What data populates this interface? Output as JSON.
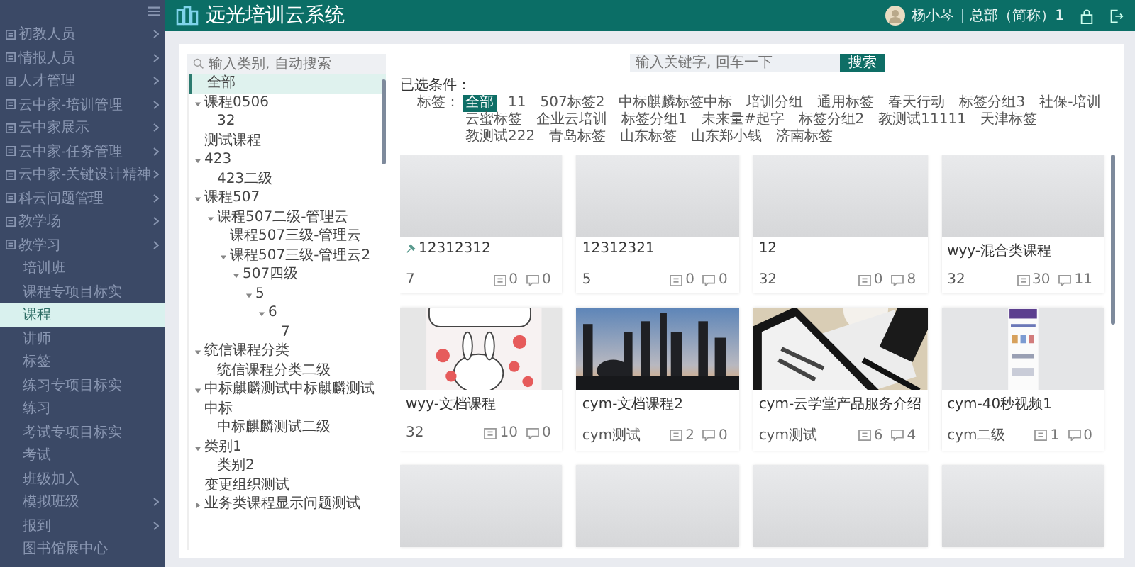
{
  "sidebar": {
    "items": [
      {
        "label": "初教人员",
        "kind": "group",
        "selected": false
      },
      {
        "label": "情报人员",
        "kind": "group",
        "selected": false
      },
      {
        "label": "人才管理",
        "kind": "group",
        "selected": false
      },
      {
        "label": "云中家-培训管理",
        "kind": "group",
        "selected": false
      },
      {
        "label": "云中家展示",
        "kind": "group",
        "selected": false
      },
      {
        "label": "云中家-任务管理",
        "kind": "group",
        "selected": false
      },
      {
        "label": "云中家-关键设计精神",
        "kind": "group",
        "selected": false
      },
      {
        "label": "科云问题管理",
        "kind": "group",
        "selected": false
      },
      {
        "label": "教学场",
        "kind": "group",
        "selected": false
      },
      {
        "label": "教学习",
        "kind": "group",
        "selected": false
      },
      {
        "label": "培训班",
        "kind": "link",
        "selected": false
      },
      {
        "label": "课程专项目标实",
        "kind": "link",
        "selected": false
      },
      {
        "label": "课程",
        "kind": "link",
        "selected": true
      },
      {
        "label": "讲师",
        "kind": "link",
        "selected": false
      },
      {
        "label": "标签",
        "kind": "link",
        "selected": false
      },
      {
        "label": "练习专项目标实",
        "kind": "link",
        "selected": false
      },
      {
        "label": "练习",
        "kind": "link",
        "selected": false
      },
      {
        "label": "考试专项目标实",
        "kind": "link",
        "selected": false
      },
      {
        "label": "考试",
        "kind": "link",
        "selected": false
      },
      {
        "label": "班级加入",
        "kind": "link",
        "selected": false
      },
      {
        "label": "模拟班级",
        "kind": "submenu",
        "selected": false
      },
      {
        "label": "报到",
        "kind": "submenu",
        "selected": false
      },
      {
        "label": "图书馆展中心",
        "kind": "link",
        "selected": false
      }
    ]
  },
  "header": {
    "title": "远光培训云系统",
    "user": "杨小琴",
    "org": "总部（简称）1"
  },
  "tree": {
    "placeholder": "输入类别, 自动搜索",
    "nodes": [
      {
        "label": "全部",
        "selected": true
      },
      {
        "label": "课程0506",
        "selected": false,
        "expanded": true,
        "children": [
          {
            "label": "32",
            "selected": false
          }
        ]
      },
      {
        "label": "测试课程",
        "selected": false
      },
      {
        "label": "423",
        "selected": false,
        "expanded": true,
        "children": [
          {
            "label": "423二级",
            "selected": false
          }
        ]
      },
      {
        "label": "课程507",
        "selected": false,
        "expanded": true,
        "children": [
          {
            "label": "课程507二级-管理云",
            "selected": false,
            "expanded": true,
            "children": [
              {
                "label": "课程507三级-管理云",
                "selected": false
              },
              {
                "label": "课程507三级-管理云2",
                "selected": false,
                "expanded": true,
                "children": [
                  {
                    "label": "507四级",
                    "selected": false,
                    "expanded": true,
                    "children": [
                      {
                        "label": "5",
                        "selected": false,
                        "expanded": true,
                        "children": [
                          {
                            "label": "6",
                            "selected": false,
                            "expanded": true,
                            "children": [
                              {
                                "label": "7",
                                "selected": false
                              }
                            ]
                          }
                        ]
                      }
                    ]
                  }
                ]
              }
            ]
          }
        ]
      },
      {
        "label": "统信课程分类",
        "selected": false,
        "expanded": true,
        "children": [
          {
            "label": "统信课程分类二级",
            "selected": false
          }
        ]
      },
      {
        "label": "中标麒麟测试中标麒麟测试中标",
        "selected": false,
        "expanded": true,
        "children": [
          {
            "label": "中标麒麟测试二级",
            "selected": false
          }
        ]
      },
      {
        "label": "类别1",
        "selected": false,
        "expanded": true,
        "children": [
          {
            "label": "类别2",
            "selected": false
          }
        ]
      },
      {
        "label": "变更组织测试",
        "selected": false
      },
      {
        "label": "业务类课程显示问题测试",
        "selected": false,
        "expanded": false
      }
    ]
  },
  "search": {
    "placeholder": "输入关键字, 回车一下",
    "button": "搜索"
  },
  "filter": {
    "title": "已选条件：",
    "tag_label": "标签：",
    "tags": [
      {
        "label": "全部",
        "selected": true
      },
      {
        "label": "11",
        "selected": false
      },
      {
        "label": "507标签2",
        "selected": false
      },
      {
        "label": "中标麒麟标签中标",
        "selected": false
      },
      {
        "label": "培训分组",
        "selected": false
      },
      {
        "label": "通用标签",
        "selected": false
      },
      {
        "label": "春天行动",
        "selected": false
      },
      {
        "label": "标签分组3",
        "selected": false
      },
      {
        "label": "社保-培训",
        "selected": false
      },
      {
        "label": "云蜜标签",
        "selected": false
      },
      {
        "label": "企业云培训",
        "selected": false
      },
      {
        "label": "标签分组1",
        "selected": false
      },
      {
        "label": "未来量#起字",
        "selected": false
      },
      {
        "label": "标签分组2",
        "selected": false
      },
      {
        "label": "教测试11111",
        "selected": false
      },
      {
        "label": "天津标签",
        "selected": false
      },
      {
        "label": "教测试222",
        "selected": false
      },
      {
        "label": "青岛标签",
        "selected": false
      },
      {
        "label": "山东标签",
        "selected": false
      },
      {
        "label": "山东郑小钱",
        "selected": false
      },
      {
        "label": "济南标签",
        "selected": false
      }
    ]
  },
  "cards": [
    {
      "kind": "placeholder",
      "pinned": true,
      "title": "12312312",
      "owner": "7",
      "lessons": "0",
      "comments": "0"
    },
    {
      "kind": "placeholder",
      "pinned": false,
      "title": "12312321",
      "owner": "5",
      "lessons": "0",
      "comments": "0"
    },
    {
      "kind": "placeholder",
      "pinned": false,
      "title": "12",
      "owner": "32",
      "lessons": "0",
      "comments": "8"
    },
    {
      "kind": "placeholder",
      "pinned": false,
      "title": "wyy-混合类课程",
      "owner": "32",
      "lessons": "30",
      "comments": "11"
    },
    {
      "kind": "cartoon",
      "pinned": false,
      "title": "wyy-文档课程",
      "owner": "32",
      "lessons": "10",
      "comments": "0"
    },
    {
      "kind": "refinery",
      "pinned": false,
      "title": "cym-文档课程2",
      "owner": "cym测试",
      "lessons": "2",
      "comments": "0"
    },
    {
      "kind": "news",
      "pinned": false,
      "title": "cym-云学堂产品服务介绍",
      "owner": "cym测试",
      "lessons": "6",
      "comments": "4"
    },
    {
      "kind": "phone",
      "pinned": false,
      "title": "cym-40秒视频1",
      "owner": "cym二级",
      "lessons": "1",
      "comments": "0"
    },
    {
      "kind": "placeholder"
    },
    {
      "kind": "placeholder"
    },
    {
      "kind": "placeholder"
    },
    {
      "kind": "placeholder"
    }
  ]
}
